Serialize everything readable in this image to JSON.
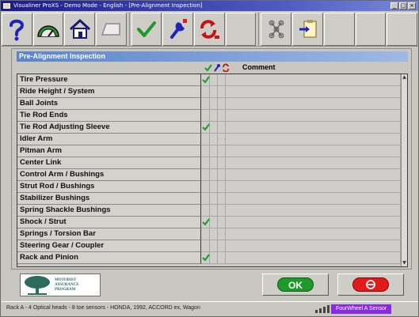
{
  "window": {
    "title": "Visualiner ProXS - Demo Mode - English - [Pre-Alignment Inspection]",
    "controls": [
      "_",
      "□",
      "×"
    ]
  },
  "toolbar": {
    "buttons": [
      {
        "name": "help",
        "icon": "question-mark-icon"
      },
      {
        "name": "gauge",
        "icon": "speedometer-icon"
      },
      {
        "name": "home",
        "icon": "home-icon"
      },
      {
        "name": "tray",
        "icon": "blank-tray-icon"
      },
      {
        "name": "accept",
        "icon": "green-check-icon"
      },
      {
        "name": "adjust",
        "icon": "wrench-icon"
      },
      {
        "name": "rotate",
        "icon": "red-arrows-icon"
      },
      {
        "name": "empty",
        "icon": ""
      },
      {
        "name": "molecule",
        "icon": "molecule-icon"
      },
      {
        "name": "export",
        "icon": "clipboard-arrow-icon"
      }
    ]
  },
  "panel": {
    "header": "Pre-Alignment Inspection",
    "comment_header": "Comment",
    "column_icons": [
      "green-check-icon",
      "blue-wrench-icon",
      "red-arrows-icon"
    ]
  },
  "rows": [
    {
      "label": "Tire Pressure",
      "checked": true
    },
    {
      "label": "Ride Height / System",
      "checked": false
    },
    {
      "label": "Ball Joints",
      "checked": false
    },
    {
      "label": "Tie Rod Ends",
      "checked": false
    },
    {
      "label": "Tie Rod Adjusting Sleeve",
      "checked": true
    },
    {
      "label": "Idler Arm",
      "checked": false
    },
    {
      "label": "Pitman Arm",
      "checked": false
    },
    {
      "label": "Center Link",
      "checked": false
    },
    {
      "label": "Control Arm / Bushings",
      "checked": false
    },
    {
      "label": "Strut Rod / Bushings",
      "checked": false
    },
    {
      "label": "Stabilizer Bushings",
      "checked": false
    },
    {
      "label": "Spring Shackle Bushings",
      "checked": false
    },
    {
      "label": "Shock / Strut",
      "checked": true
    },
    {
      "label": "Springs / Torsion Bar",
      "checked": false
    },
    {
      "label": "Steering Gear / Coupler",
      "checked": false
    },
    {
      "label": "Rack and Pinion",
      "checked": true
    }
  ],
  "logo": {
    "text_lines": [
      "MOTORIST",
      "ASSURANCE",
      "PROGRAM"
    ],
    "color": "#2d6b5e"
  },
  "buttons": {
    "ok_label": "OK",
    "ok_color": "#1e9a2a",
    "cancel_color": "#e11a1a"
  },
  "status": {
    "text": "Rack A - 4 Optical heads - 8 toe sensors - HONDA, 1992, ACCORD ex, Wagon",
    "badge": "FourWheel A Sensor",
    "badge_color": "#8a2be2"
  }
}
